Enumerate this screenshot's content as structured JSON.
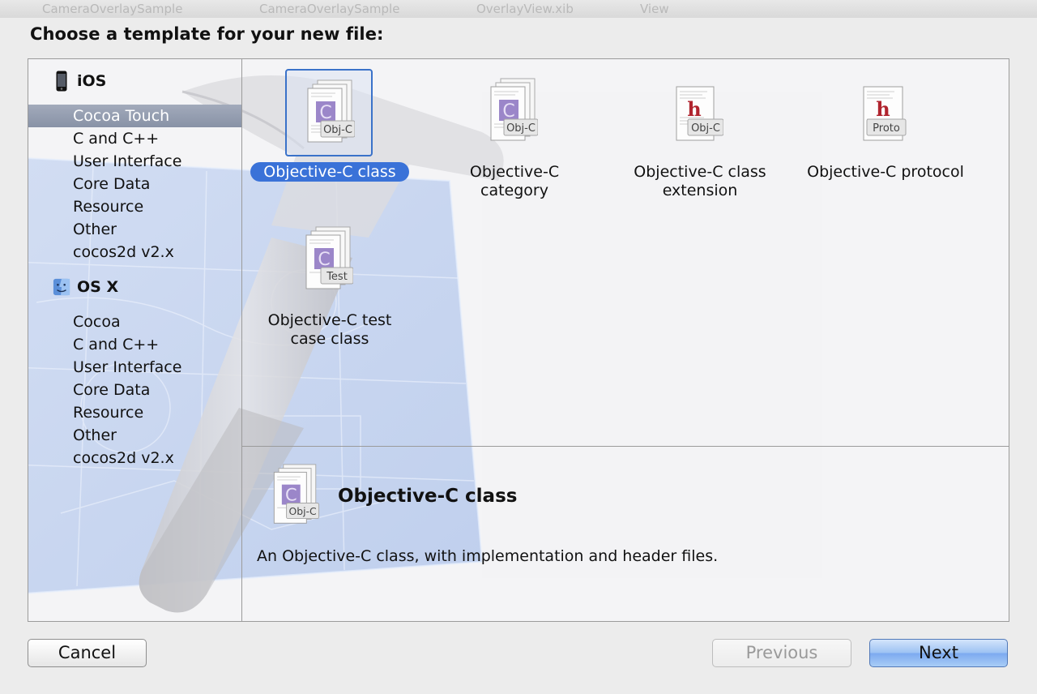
{
  "window": {
    "breadcrumbs": [
      "CameraOverlaySample",
      "CameraOverlaySample",
      "OverlayView.xib",
      "View"
    ]
  },
  "heading": "Choose a template for your new file:",
  "sidebar": {
    "groups": [
      {
        "label": "iOS",
        "icon": "iphone-icon",
        "items": [
          "Cocoa Touch",
          "C and C++",
          "User Interface",
          "Core Data",
          "Resource",
          "Other",
          "cocos2d v2.x"
        ]
      },
      {
        "label": "OS X",
        "icon": "finder-icon",
        "items": [
          "Cocoa",
          "C and C++",
          "User Interface",
          "Core Data",
          "Resource",
          "Other",
          "cocos2d v2.x"
        ]
      }
    ],
    "selected": "Cocoa Touch"
  },
  "templates": [
    {
      "line1": "Objective-C class",
      "line2": "",
      "badge": "Obj-C",
      "letter": "C",
      "icon": "objc-class-file-icon",
      "selected": true
    },
    {
      "line1": "Objective-C",
      "line2": "category",
      "badge": "Obj-C",
      "letter": "C",
      "icon": "objc-category-file-icon",
      "selected": false
    },
    {
      "line1": "Objective-C class",
      "line2": "extension",
      "badge": "Obj-C",
      "letter": "h",
      "icon": "objc-extension-file-icon",
      "selected": false
    },
    {
      "line1": "Objective-C protocol",
      "line2": "",
      "badge": "Proto",
      "letter": "h",
      "icon": "objc-protocol-file-icon",
      "selected": false
    },
    {
      "line1": "Objective-C test",
      "line2": "case class",
      "badge": "Test",
      "letter": "C",
      "icon": "objc-test-file-icon",
      "selected": false
    }
  ],
  "description": {
    "title": "Objective-C class",
    "badge": "Obj-C",
    "text": "An Objective-C class, with implementation and header files."
  },
  "buttons": {
    "cancel": "Cancel",
    "previous": "Previous",
    "next": "Next"
  },
  "colors": {
    "selection": "#3a72d8",
    "sidebar_selection": "#8e97aa",
    "c_badge": "#9b86c9",
    "h_letter": "#b0242e",
    "primary_button": "#7daaf0"
  }
}
